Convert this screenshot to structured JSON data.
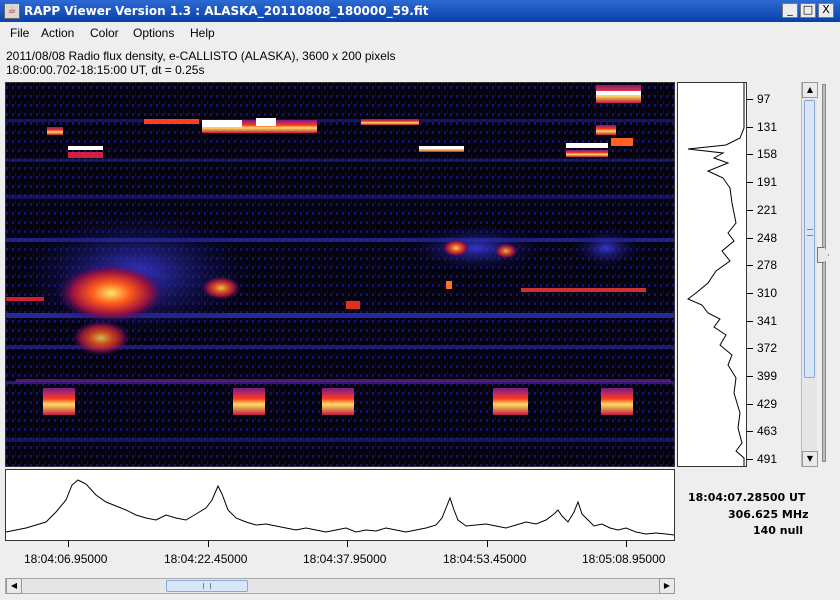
{
  "window": {
    "title": "RAPP Viewer Version 1.3 : ALASKA_20110808_180000_59.fit",
    "app_icon": "java-cup-icon",
    "min_label": "_",
    "max_label": "□",
    "close_label": "X"
  },
  "menu": {
    "file": "File",
    "action": "Action",
    "color": "Color",
    "options": "Options",
    "help": "Help"
  },
  "header": {
    "line1": "2011/08/08  Radio flux density, e-CALLISTO (ALASKA),  3600 x 200 pixels",
    "line2": "18:00:00.702-18:15:00 UT,  dt = 0.25s"
  },
  "frequency_axis": {
    "ticks": [
      "97",
      "131",
      "158",
      "191",
      "221",
      "248",
      "278",
      "310",
      "341",
      "372",
      "399",
      "429",
      "463",
      "491"
    ]
  },
  "time_axis": {
    "ticks": [
      "18:04:06.95000",
      "18:04:22.45000",
      "18:04:37.95000",
      "18:04:53.45000",
      "18:05:08.95000"
    ]
  },
  "cursor_readout": {
    "time": "18:04:07.28500 UT",
    "frequency": "306.625 MHz",
    "value": "140 null"
  },
  "scrollbars": {
    "up_icon": "arrow-up-icon",
    "down_icon": "arrow-down-icon",
    "left_icon": "arrow-left-icon",
    "right_icon": "arrow-right-icon"
  },
  "colors": {
    "titlebar": "#0a3fa8",
    "plot_background": "#04020f",
    "profile_line": "#000000"
  }
}
